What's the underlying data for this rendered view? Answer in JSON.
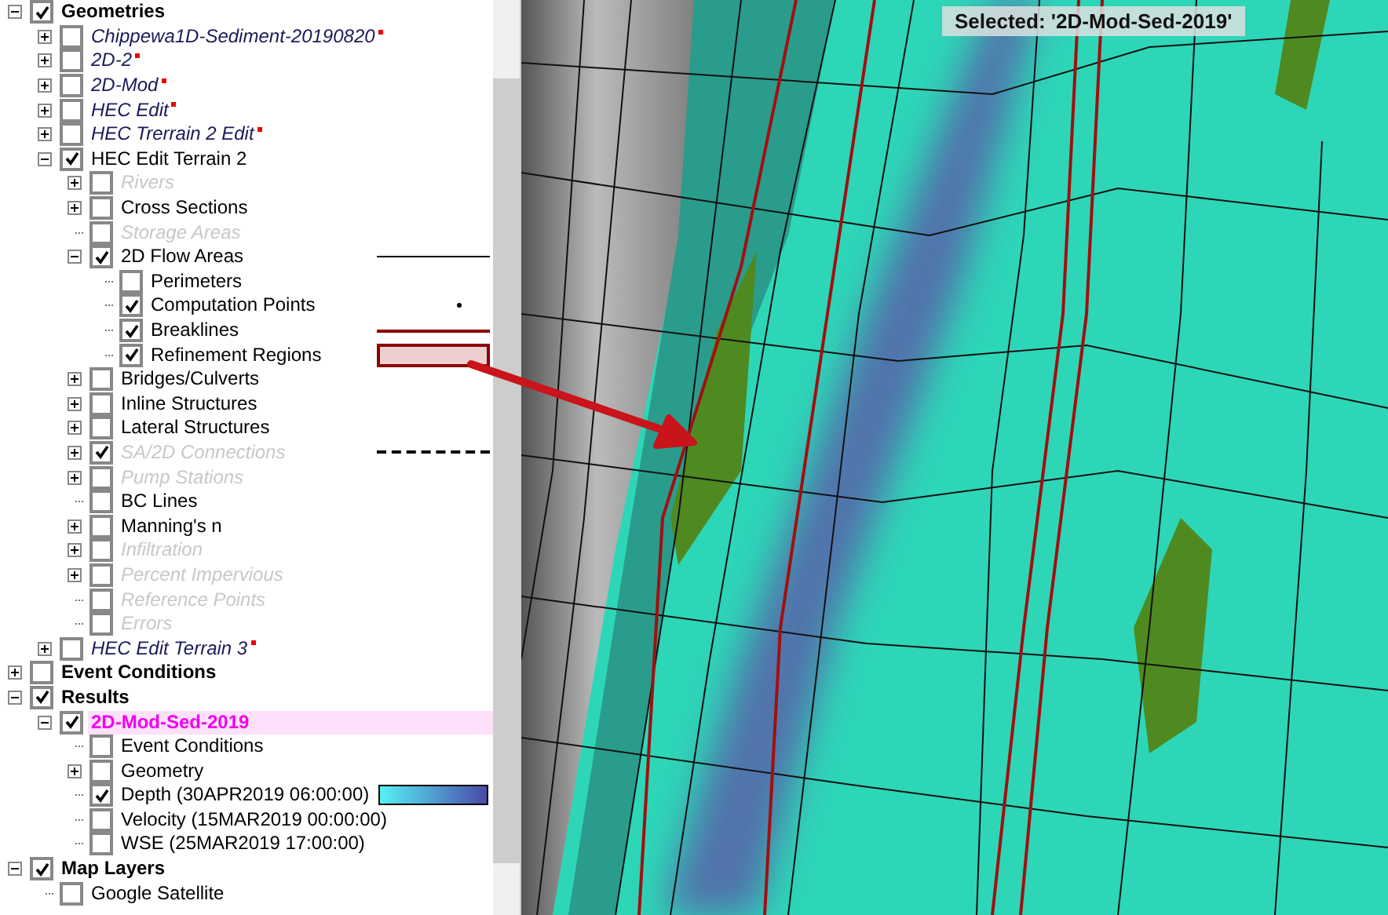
{
  "tree": [
    {
      "label": "Geometries",
      "kind": "group",
      "checked": true,
      "expanded": true,
      "selected": false,
      "children": [
        {
          "label": "Chippewa1D-Sediment-20190820",
          "kind": "unloaded",
          "modified": true,
          "checked": false,
          "expanded": false,
          "selected": false
        },
        {
          "label": "2D-2",
          "kind": "unloaded",
          "modified": true,
          "checked": false,
          "expanded": false,
          "selected": false
        },
        {
          "label": "2D-Mod",
          "kind": "unloaded",
          "modified": true,
          "checked": false,
          "expanded": false,
          "selected": false
        },
        {
          "label": "HEC Edit",
          "kind": "unloaded",
          "modified": true,
          "checked": false,
          "expanded": false,
          "selected": false
        },
        {
          "label": "HEC Trerrain 2 Edit",
          "kind": "unloaded",
          "modified": true,
          "checked": false,
          "expanded": false,
          "selected": false
        },
        {
          "label": "HEC Edit Terrain 2",
          "kind": "layer",
          "checked": true,
          "expanded": true,
          "selected": false,
          "children": [
            {
              "label": "Rivers",
              "kind": "disabled",
              "checked": false,
              "expanded": false,
              "selected": false
            },
            {
              "label": "Cross Sections",
              "kind": "layer",
              "checked": false,
              "expanded": false,
              "selected": false
            },
            {
              "label": "Storage Areas",
              "kind": "disabled",
              "checked": false,
              "selected": false
            },
            {
              "label": "2D Flow Areas",
              "kind": "layer",
              "checked": true,
              "expanded": true,
              "legend": {
                "kind": "line"
              },
              "selected": false,
              "children": [
                {
                  "label": "Perimeters",
                  "kind": "layer",
                  "checked": false,
                  "selected": false
                },
                {
                  "label": "Computation Points",
                  "kind": "layer",
                  "checked": true,
                  "legend": {
                    "kind": "point"
                  },
                  "selected": false
                },
                {
                  "label": "Breaklines",
                  "kind": "layer",
                  "checked": true,
                  "legend": {
                    "kind": "red-line"
                  },
                  "selected": false
                },
                {
                  "label": "Refinement Regions",
                  "kind": "layer",
                  "checked": true,
                  "legend": {
                    "kind": "red-box"
                  },
                  "selected": false
                }
              ]
            },
            {
              "label": "Bridges/Culverts",
              "kind": "layer",
              "checked": false,
              "expanded": false,
              "selected": false
            },
            {
              "label": "Inline Structures",
              "kind": "layer",
              "checked": false,
              "expanded": false,
              "selected": false
            },
            {
              "label": "Lateral Structures",
              "kind": "layer",
              "checked": false,
              "expanded": false,
              "selected": false
            },
            {
              "label": "SA/2D Connections",
              "kind": "disabled",
              "checked": true,
              "expanded": false,
              "legend": {
                "kind": "dashed"
              },
              "selected": false
            },
            {
              "label": "Pump Stations",
              "kind": "disabled",
              "checked": false,
              "expanded": false,
              "selected": false
            },
            {
              "label": "BC Lines",
              "kind": "layer",
              "checked": false,
              "selected": false
            },
            {
              "label": "Manning's n",
              "kind": "layer",
              "checked": false,
              "expanded": false,
              "selected": false
            },
            {
              "label": "Infiltration",
              "kind": "disabled",
              "checked": false,
              "expanded": false,
              "selected": false
            },
            {
              "label": "Percent Impervious",
              "kind": "disabled",
              "checked": false,
              "expanded": false,
              "selected": false
            },
            {
              "label": "Reference Points",
              "kind": "disabled",
              "checked": false,
              "selected": false
            },
            {
              "label": "Errors",
              "kind": "disabled",
              "checked": false,
              "selected": false
            }
          ]
        },
        {
          "label": "HEC Edit Terrain 3",
          "kind": "unloaded",
          "modified": true,
          "checked": false,
          "expanded": false,
          "selected": false
        }
      ]
    },
    {
      "label": "Event Conditions",
      "kind": "group",
      "checked": false,
      "expanded": false,
      "selected": false
    },
    {
      "label": "Results",
      "kind": "group",
      "checked": true,
      "expanded": true,
      "selected": false,
      "children": [
        {
          "label": "2D-Mod-Sed-2019",
          "kind": "result",
          "checked": true,
          "expanded": true,
          "selected": true,
          "children": [
            {
              "label": "Event Conditions",
              "kind": "layer",
              "checked": false,
              "selected": false
            },
            {
              "label": "Geometry",
              "kind": "layer",
              "checked": false,
              "expanded": false,
              "selected": false
            },
            {
              "label": "Depth (30APR2019 06:00:00)",
              "kind": "layer",
              "checked": true,
              "legend": {
                "kind": "gradient"
              },
              "selected": false
            },
            {
              "label": "Velocity (15MAR2019 00:00:00)",
              "kind": "layer",
              "checked": false,
              "selected": false
            },
            {
              "label": "WSE (25MAR2019 17:00:00)",
              "kind": "layer",
              "checked": false,
              "selected": false
            }
          ]
        }
      ]
    },
    {
      "label": "Map Layers",
      "kind": "group",
      "checked": true,
      "expanded": true,
      "selected": false,
      "children": [
        {
          "label": "Google Satellite",
          "kind": "layer",
          "checked": false,
          "selected": false
        }
      ]
    }
  ],
  "map": {
    "selection_label": "Selected: '2D-Mod-Sed-2019'"
  }
}
